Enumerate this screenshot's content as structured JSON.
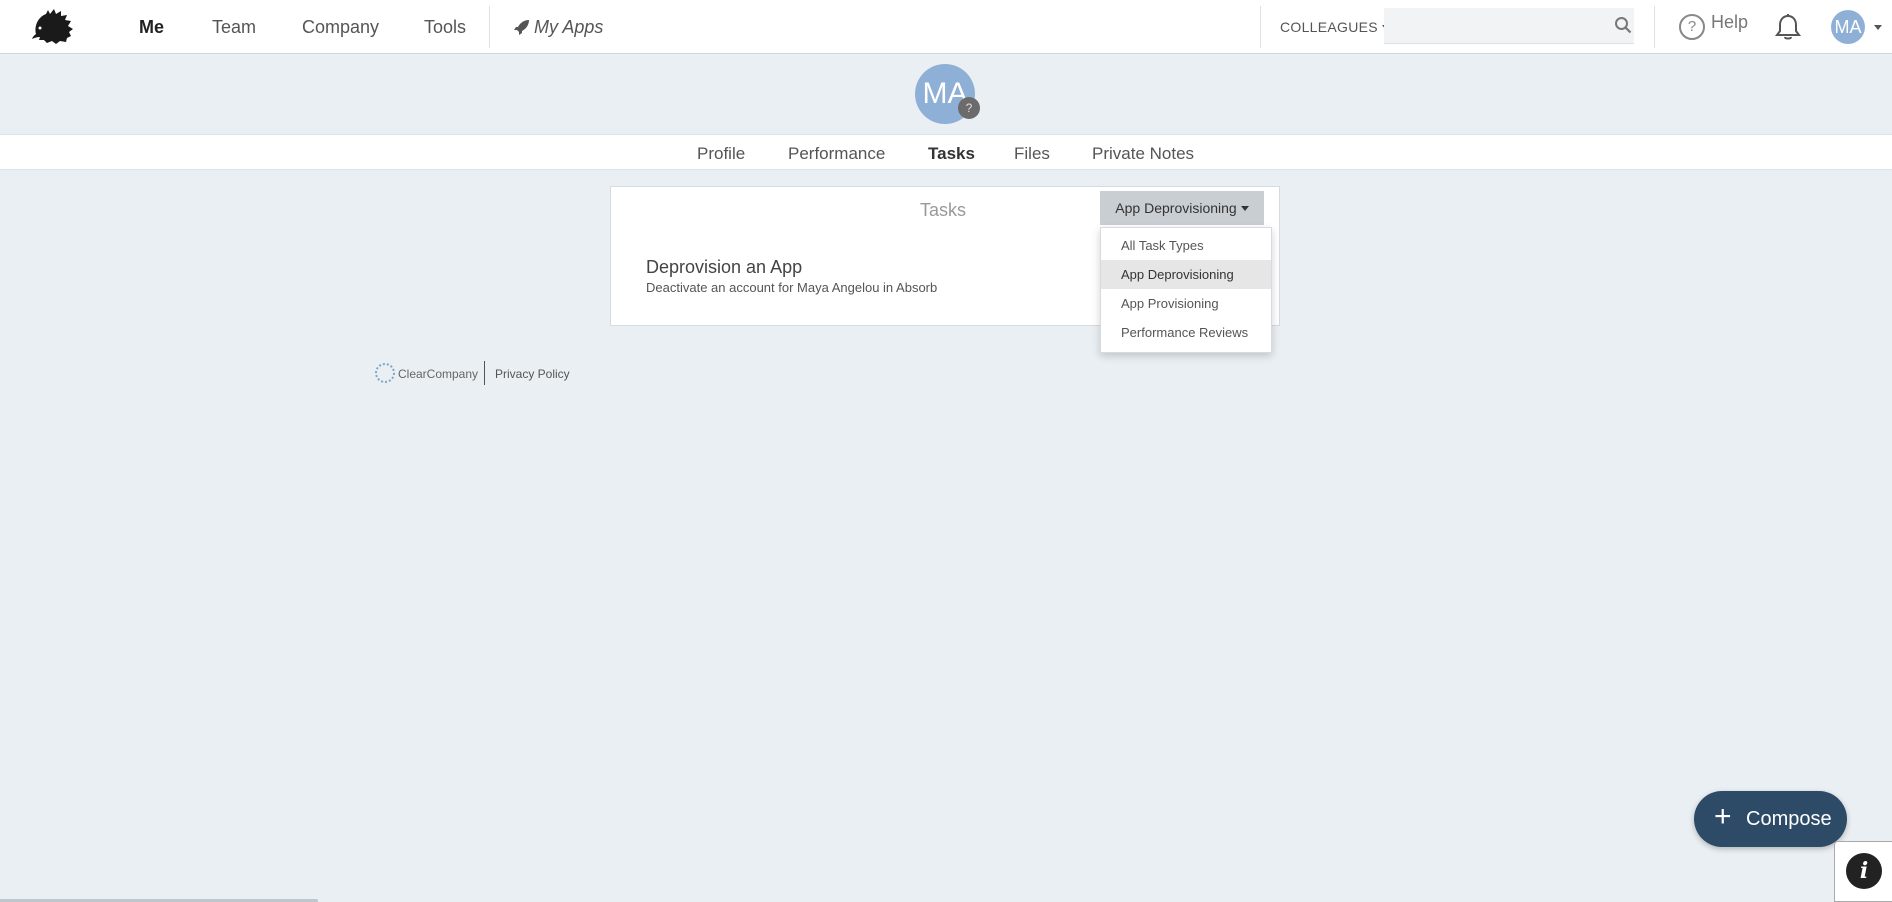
{
  "nav": {
    "items": [
      {
        "label": "Me",
        "active": true
      },
      {
        "label": "Team",
        "active": false
      },
      {
        "label": "Company",
        "active": false
      },
      {
        "label": "Tools",
        "active": false
      }
    ],
    "my_apps_label": "My Apps",
    "colleagues_label": "COLLEAGUES",
    "search_placeholder": "",
    "search_value": "",
    "help_label": "Help",
    "user_initials": "MA"
  },
  "profile": {
    "initials": "MA",
    "badge": "?",
    "tabs": [
      {
        "label": "Profile",
        "active": false
      },
      {
        "label": "Performance",
        "active": false
      },
      {
        "label": "Tasks",
        "active": true
      },
      {
        "label": "Files",
        "active": false
      },
      {
        "label": "Private Notes",
        "active": false
      }
    ]
  },
  "tasks": {
    "title": "Tasks",
    "filter_label": "App Deprovisioning",
    "filter_options": [
      {
        "label": "All Task Types",
        "selected": false
      },
      {
        "label": "App Deprovisioning",
        "selected": true
      },
      {
        "label": "App Provisioning",
        "selected": false
      },
      {
        "label": "Performance Reviews",
        "selected": false
      }
    ],
    "items": [
      {
        "title": "Deprovision an App",
        "description": "Deactivate an account for Maya Angelou in Absorb"
      }
    ]
  },
  "footer": {
    "brand": "ClearCompany",
    "privacy_label": "Privacy Policy"
  },
  "compose": {
    "label": "Compose"
  },
  "colors": {
    "page_bg": "#eaeff3",
    "avatar": "#8fb0d6",
    "compose_bg": "#2d4b67",
    "selected_option_bg": "#e6e6e6"
  },
  "icons": [
    "hedgehog-logo",
    "rocket-icon",
    "search-icon",
    "help-icon",
    "bell-icon",
    "plus-icon",
    "info-icon"
  ]
}
